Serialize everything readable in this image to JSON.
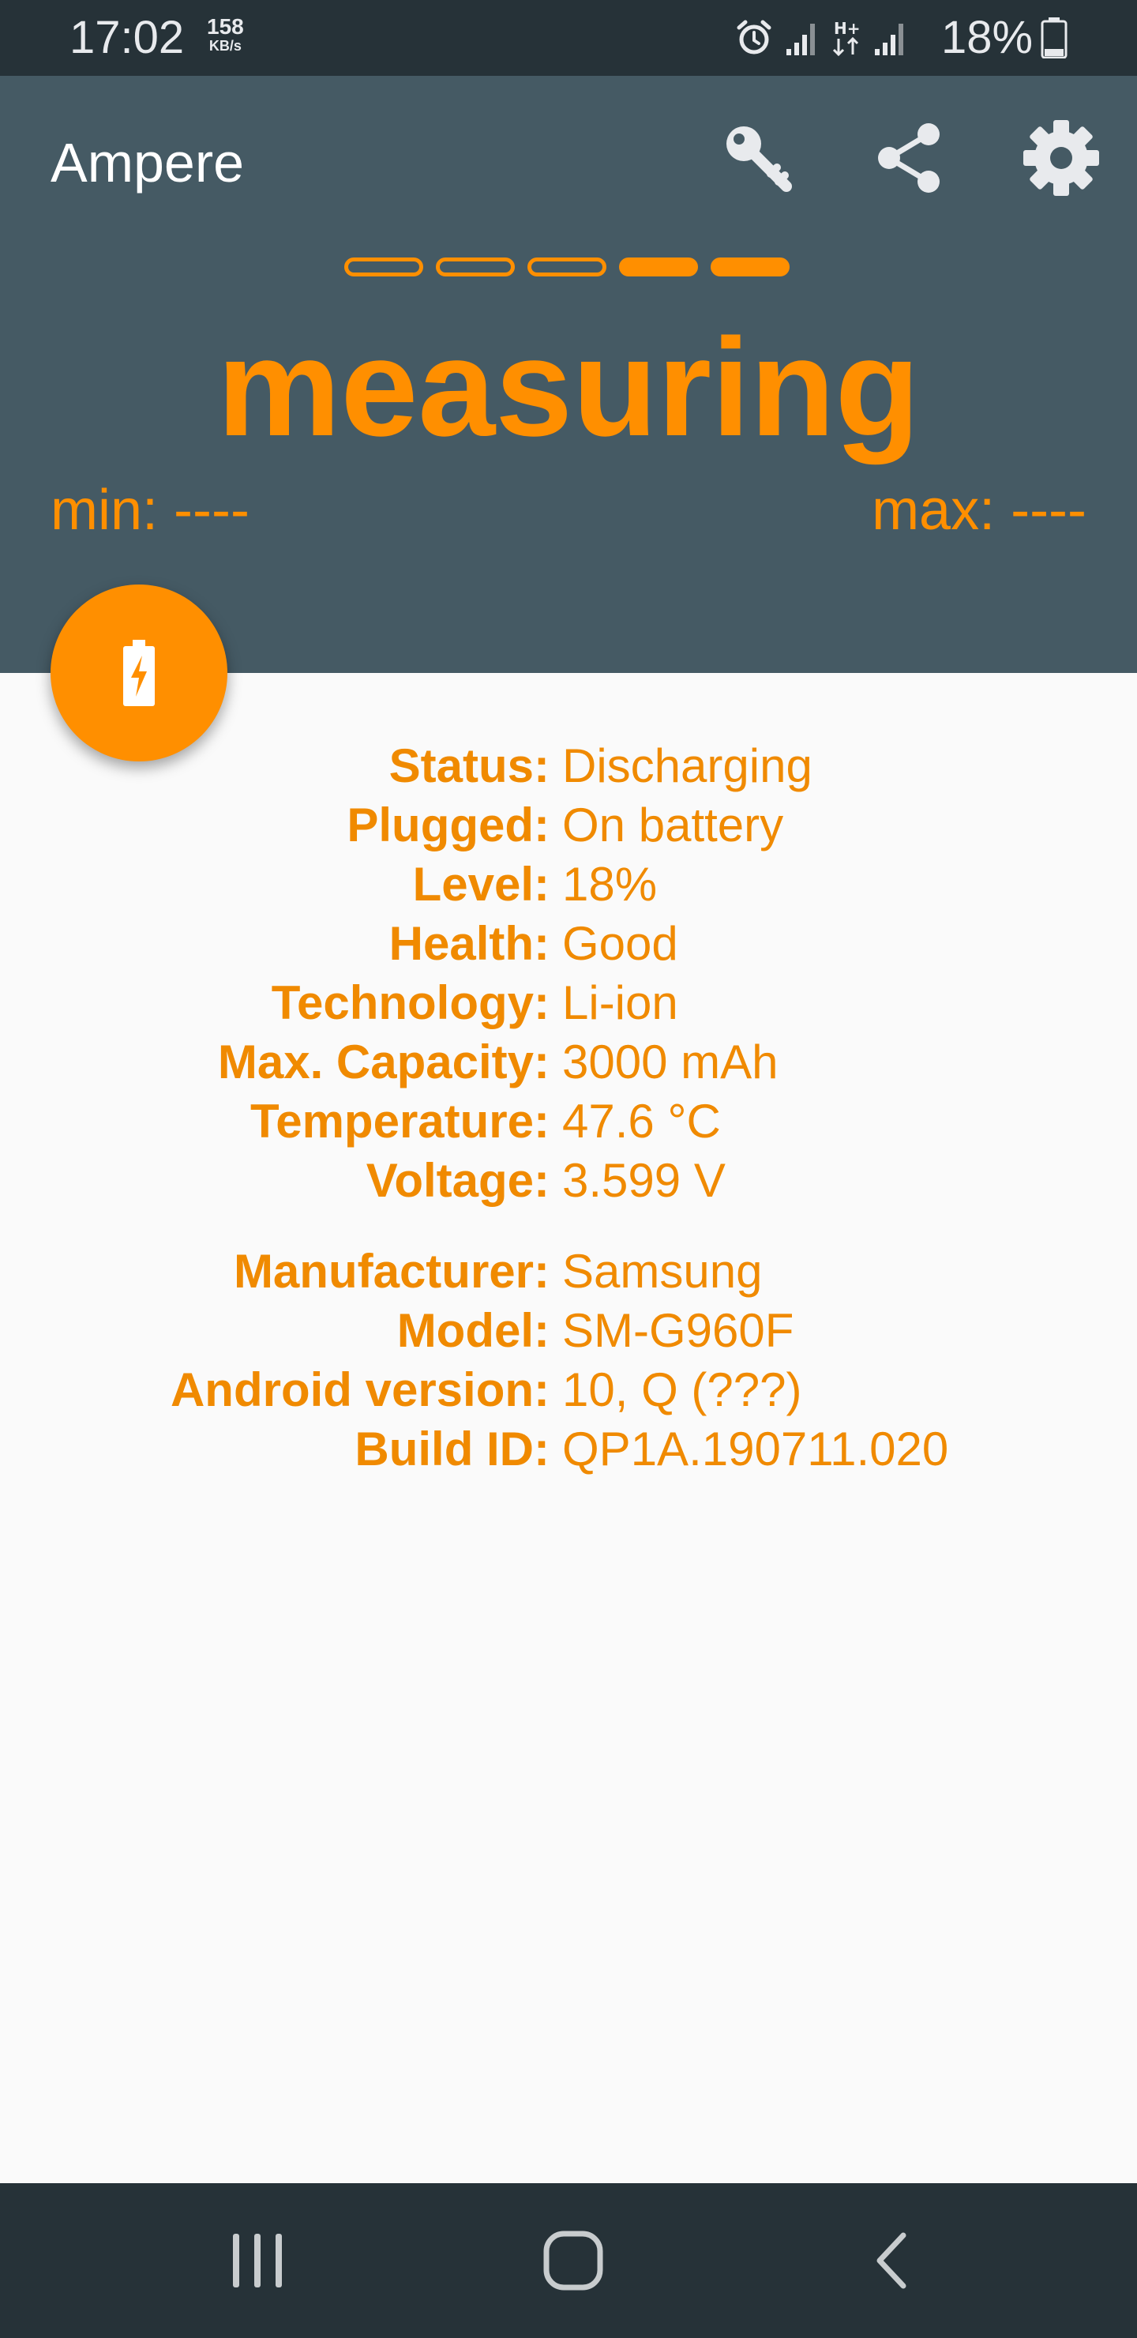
{
  "status_bar": {
    "time": "17:02",
    "net_speed_value": "158",
    "net_speed_unit": "KB/s",
    "battery_percent": "18%"
  },
  "app": {
    "title": "Ampere",
    "status_text": "measuring",
    "min_label": "min: ----",
    "max_label": "max: ----",
    "accent_color": "#ff8f00",
    "header_color": "#455a64"
  },
  "battery_info": [
    {
      "label": "Status:",
      "value": "Discharging"
    },
    {
      "label": "Plugged:",
      "value": "On battery"
    },
    {
      "label": "Level:",
      "value": "18%"
    },
    {
      "label": "Health:",
      "value": "Good"
    },
    {
      "label": "Technology:",
      "value": "Li-ion"
    },
    {
      "label": "Max. Capacity:",
      "value": "3000 mAh"
    },
    {
      "label": "Temperature:",
      "value": "47.6 °C"
    },
    {
      "label": "Voltage:",
      "value": "3.599 V"
    }
  ],
  "device_info": [
    {
      "label": "Manufacturer:",
      "value": "Samsung"
    },
    {
      "label": "Model:",
      "value": "SM-G960F"
    },
    {
      "label": "Android version:",
      "value": "10, Q (???)"
    },
    {
      "label": "Build ID:",
      "value": "QP1A.190711.020"
    }
  ]
}
